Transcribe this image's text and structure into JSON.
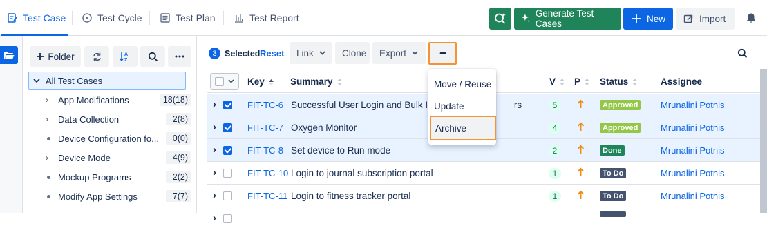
{
  "nav": {
    "tabs": [
      {
        "label": "Test Case",
        "active": true
      },
      {
        "label": "Test Cycle"
      },
      {
        "label": "Test Plan"
      },
      {
        "label": "Test Report"
      }
    ],
    "generate_label": "Generate Test Cases",
    "new_label": "New",
    "import_label": "Import"
  },
  "folders": {
    "add_label": "Folder",
    "root_label": "All Test Cases",
    "items": [
      {
        "name": "App Modifications",
        "count": "18(18)",
        "expandable": true
      },
      {
        "name": "Data Collection",
        "count": "2(8)",
        "expandable": true
      },
      {
        "name": "Device Configuration fo...",
        "count": "0(0)",
        "expandable": false
      },
      {
        "name": "Device Mode",
        "count": "4(9)",
        "expandable": true
      },
      {
        "name": "Mockup Programs",
        "count": "2(2)",
        "expandable": false
      },
      {
        "name": "Modify App Settings",
        "count": "7(7)",
        "expandable": false
      }
    ]
  },
  "selection": {
    "count": "3",
    "selected_label": "Selected",
    "reset_label": "Reset"
  },
  "actions": {
    "link_label": "Link",
    "clone_label": "Clone",
    "export_label": "Export",
    "more_label": "•••"
  },
  "menu": {
    "items": [
      "Move / Reuse",
      "Update",
      "Archive"
    ],
    "highlighted": "Archive"
  },
  "table": {
    "headers": {
      "key": "Key",
      "summary": "Summary",
      "version": "V",
      "priority": "P",
      "status": "Status",
      "assignee": "Assignee"
    },
    "rows": [
      {
        "key": "FIT-TC-6",
        "summary": "Successful User Login and Bulk Imp",
        "summary_tail": "rs",
        "version": "5",
        "status": "Approved",
        "status_color": "#94c748",
        "assignee": "Mrunalini Potnis",
        "checked": true
      },
      {
        "key": "FIT-TC-7",
        "summary": "Oxygen Monitor",
        "summary_tail": "",
        "version": "4",
        "status": "Approved",
        "status_color": "#94c748",
        "assignee": "Mrunalini Potnis",
        "checked": true
      },
      {
        "key": "FIT-TC-8",
        "summary": "Set device to Run mode",
        "summary_tail": "",
        "version": "2",
        "status": "Done",
        "status_color": "#1f845a",
        "assignee": "Mrunalini Potnis",
        "checked": true
      },
      {
        "key": "FIT-TC-10",
        "summary": "Login to journal subscription portal",
        "summary_tail": "",
        "version": "1",
        "status": "To Do",
        "status_color": "#44546f",
        "assignee": "Mrunalini Potnis",
        "checked": false
      },
      {
        "key": "FIT-TC-11",
        "summary": "Login to fitness tracker portal",
        "summary_tail": "",
        "version": "1",
        "status": "To Do",
        "status_color": "#44546f",
        "assignee": "Mrunalini Potnis",
        "checked": false
      },
      {
        "key": "",
        "summary": "",
        "summary_tail": "",
        "version": "",
        "status": "",
        "status_color": "#44546f",
        "assignee": "",
        "checked": false
      }
    ]
  },
  "colors": {
    "accent": "#0c66e4",
    "green": "#1f845a",
    "highlight": "#f79233",
    "priority": "#f18d13"
  }
}
